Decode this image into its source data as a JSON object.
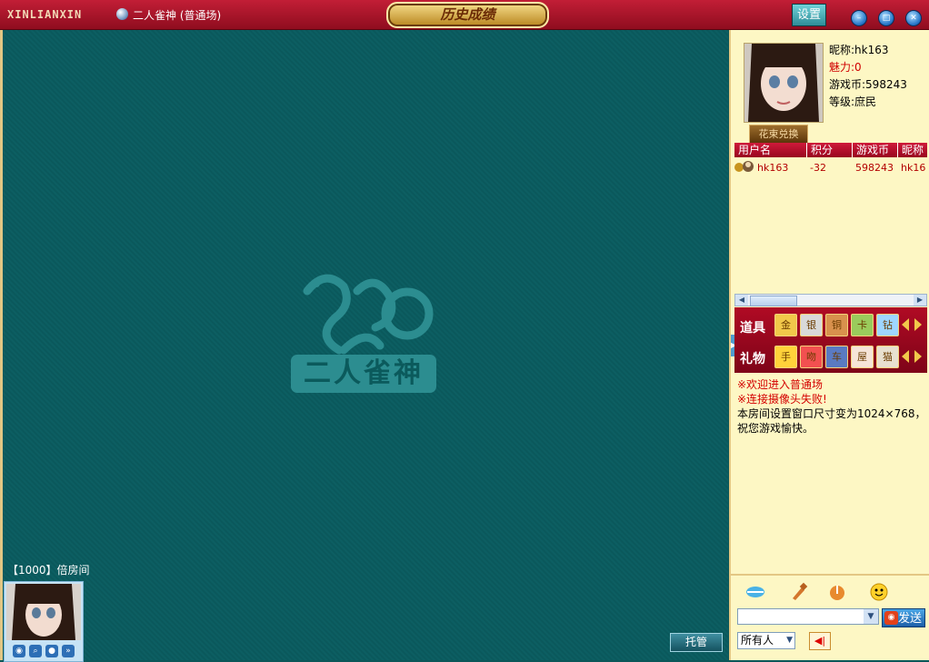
{
  "titlebar": {
    "brand": "XINLIANXIN",
    "room_title": "二人雀神 (普通场)",
    "crest_text": "历史成绩",
    "settings_label": "设置"
  },
  "game": {
    "logo_text": "二人雀神",
    "room_label": "【1000】倍房间",
    "trust_label": "托管"
  },
  "profile": {
    "nickname": "昵称:hk163",
    "charm": "魅力:0",
    "coins": "游戏币:598243",
    "level": "等级:庶民",
    "exchange_label": "花束兑换"
  },
  "user_table": {
    "headers": [
      "用户名",
      "积分",
      "游戏币",
      "昵称"
    ],
    "rows": [
      {
        "username": "hk163",
        "score": "-32",
        "coins": "598243",
        "nickname": "hk16"
      }
    ]
  },
  "items": {
    "props_label": "道具",
    "gifts_label": "礼物",
    "props": [
      "金",
      "银",
      "铜",
      "卡",
      "钻"
    ],
    "gifts": [
      "手",
      "吻",
      "车",
      "屋",
      "猫"
    ]
  },
  "messages": [
    {
      "text": "※欢迎进入普通场",
      "color": "red"
    },
    {
      "text": "※连接摄像头失败!",
      "color": "red"
    },
    {
      "text": "本房间设置窗口尺寸变为1024×768，祝您游戏愉快。",
      "color": "black"
    }
  ],
  "chat": {
    "send_label": "发送",
    "target_value": "所有人"
  },
  "colors": {
    "titlebar": "#b2142d",
    "table_felt": "#0b5759",
    "sidebar_bg": "#fdf7c4",
    "message_red": "#d40000"
  }
}
